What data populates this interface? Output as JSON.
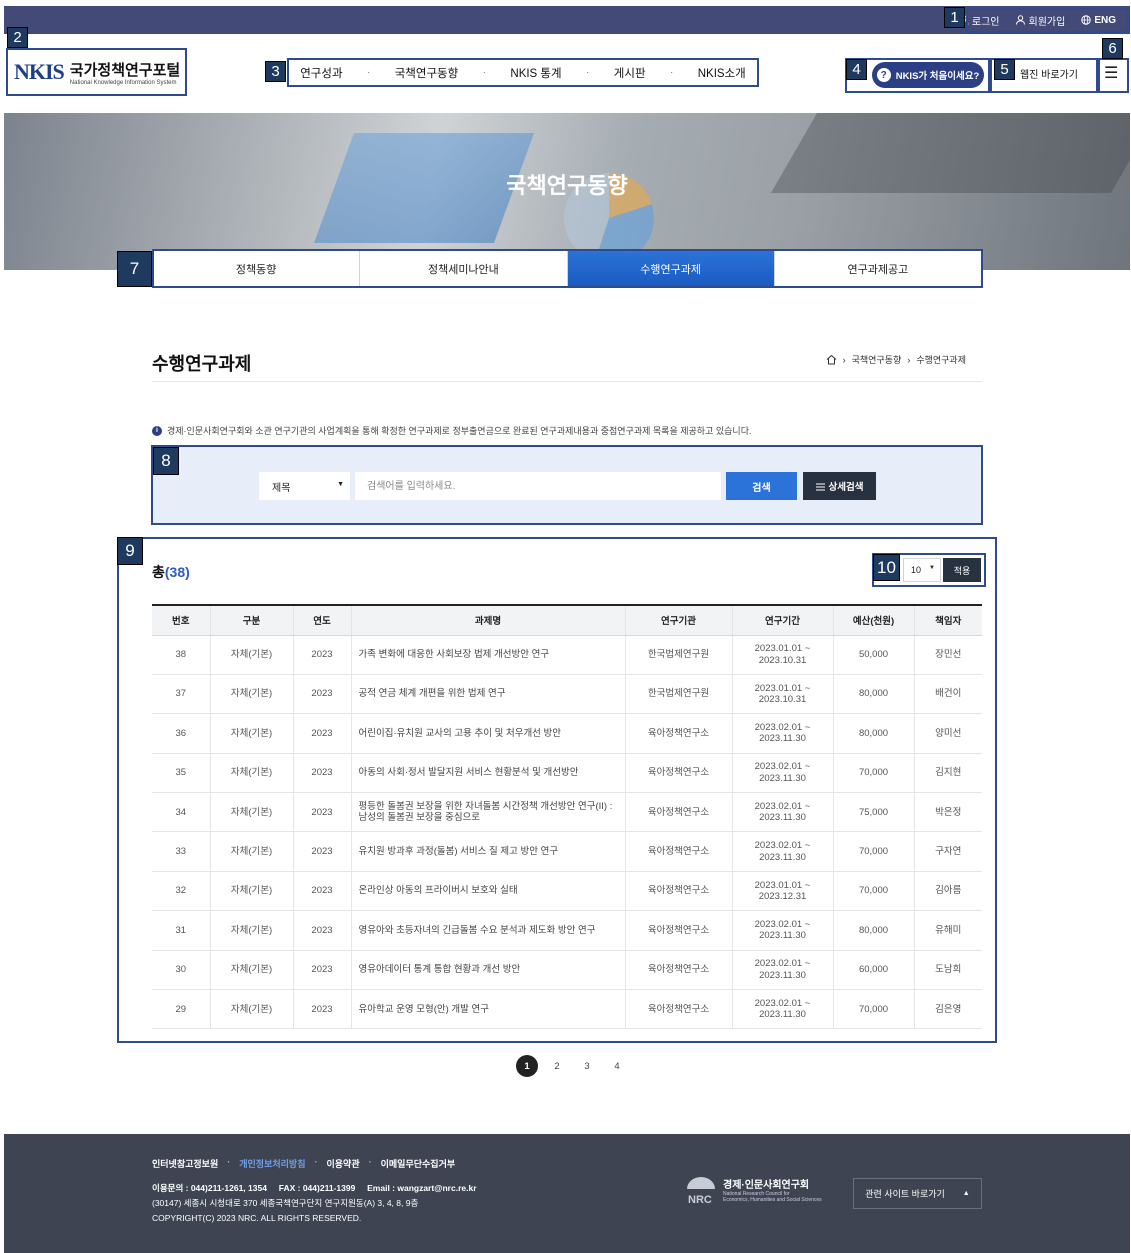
{
  "util": {
    "login": "로그인",
    "signup": "회원가입",
    "lang": "ENG"
  },
  "logo": {
    "mark": "NKIS",
    "name_ko": "국가정책연구포털",
    "name_en": "National Knowledge Information System"
  },
  "gnb": [
    "연구성과",
    "국책연구동향",
    "NKIS 통계",
    "게시판",
    "NKIS소개"
  ],
  "header": {
    "first_visit": "NKIS가 처음이세요?",
    "webzine": "웹진 바로가기"
  },
  "hero_title": "국책연구동향",
  "tabs": [
    {
      "label": "정책동향",
      "active": false
    },
    {
      "label": "정책세미나안내",
      "active": false
    },
    {
      "label": "수행연구과제",
      "active": true
    },
    {
      "label": "연구과제공고",
      "active": false
    }
  ],
  "page_title": "수행연구과제",
  "breadcrumb": [
    "국책연구동향",
    "수행연구과제"
  ],
  "notice": "경제·인문사회연구회와 소관 연구기관의 사업계획을 통해 확정한 연구과제로 정부출연금으로 완료된 연구과제내용과 중점연구과제 목록을 제공하고 있습니다.",
  "search": {
    "field": "제목",
    "placeholder": "검색어를 입력하세요.",
    "button": "검색",
    "detail_button": "상세검색"
  },
  "list": {
    "total_label": "총",
    "total_count": "(38)",
    "per_page": "10",
    "apply": "적용",
    "columns": [
      "번호",
      "구분",
      "연도",
      "과제명",
      "연구기관",
      "연구기간",
      "예산(천원)",
      "책임자"
    ],
    "rows": [
      {
        "no": "38",
        "type": "자체(기본)",
        "year": "2023",
        "title": "가족 변화에 대응한 사회보장 법제 개선방안 연구",
        "org": "한국법제연구원",
        "period_start": "2023.01.01 ~",
        "period_end": "2023.10.31",
        "budget": "50,000",
        "lead": "장민선"
      },
      {
        "no": "37",
        "type": "자체(기본)",
        "year": "2023",
        "title": "공적 연금 체계 개편을 위한 법제 연구",
        "org": "한국법제연구원",
        "period_start": "2023.01.01 ~",
        "period_end": "2023.10.31",
        "budget": "80,000",
        "lead": "배건이"
      },
      {
        "no": "36",
        "type": "자체(기본)",
        "year": "2023",
        "title": "어린이집·유치원 교사의 고용 추이 및 처우개선 방안",
        "org": "육아정책연구소",
        "period_start": "2023.02.01 ~",
        "period_end": "2023.11.30",
        "budget": "80,000",
        "lead": "양미선"
      },
      {
        "no": "35",
        "type": "자체(기본)",
        "year": "2023",
        "title": "아동의 사회·정서 발달지원 서비스 현황분석 및 개선방안",
        "org": "육아정책연구소",
        "period_start": "2023.02.01 ~",
        "period_end": "2023.11.30",
        "budget": "70,000",
        "lead": "김지현"
      },
      {
        "no": "34",
        "type": "자체(기본)",
        "year": "2023",
        "title": "평등한 돌봄권 보장을 위한 자녀돌봄 시간정책 개선방안 연구(II) : 남성의 돌봄권 보장을 중심으로",
        "org": "육아정책연구소",
        "period_start": "2023.02.01 ~",
        "period_end": "2023.11.30",
        "budget": "75,000",
        "lead": "박은정"
      },
      {
        "no": "33",
        "type": "자체(기본)",
        "year": "2023",
        "title": "유치원 방과후 과정(돌봄) 서비스 질 제고 방안 연구",
        "org": "육아정책연구소",
        "period_start": "2023.02.01 ~",
        "period_end": "2023.11.30",
        "budget": "70,000",
        "lead": "구자연"
      },
      {
        "no": "32",
        "type": "자체(기본)",
        "year": "2023",
        "title": "온라인상 아동의 프라이버시 보호와 실태",
        "org": "육아정책연구소",
        "period_start": "2023.01.01 ~",
        "period_end": "2023.12.31",
        "budget": "70,000",
        "lead": "김아름"
      },
      {
        "no": "31",
        "type": "자체(기본)",
        "year": "2023",
        "title": "영유아와 초등자녀의 긴급돌봄 수요 분석과 제도화 방안 연구",
        "org": "육아정책연구소",
        "period_start": "2023.02.01 ~",
        "period_end": "2023.11.30",
        "budget": "80,000",
        "lead": "유해미"
      },
      {
        "no": "30",
        "type": "자체(기본)",
        "year": "2023",
        "title": "영유아데이터 통계 통합 현황과 개선 방안",
        "org": "육아정책연구소",
        "period_start": "2023.02.01 ~",
        "period_end": "2023.11.30",
        "budget": "60,000",
        "lead": "도남희"
      },
      {
        "no": "29",
        "type": "자체(기본)",
        "year": "2023",
        "title": "유아학교 운영 모형(안) 개발 연구",
        "org": "육아정책연구소",
        "period_start": "2023.02.01 ~",
        "period_end": "2023.11.30",
        "budget": "70,000",
        "lead": "김은영"
      }
    ]
  },
  "pagination": {
    "pages": [
      "1",
      "2",
      "3",
      "4"
    ],
    "current": "1"
  },
  "footer": {
    "links": [
      "인터넷참고정보원",
      "개인정보처리방침",
      "이용약관",
      "이메일무단수집거부"
    ],
    "contact_label": "이용문의 : 044)211-1261, 1354",
    "fax_label": "FAX : 044)211-1399",
    "email_label": "Email : wangzart@nrc.re.kr",
    "address": "(30147) 세종시 시청대로 370 세종국책연구단지 연구지원동(A) 3, 4, 8, 9층",
    "copyright": "COPYRIGHT(C) 2023 NRC. ALL RIGHTS RESERVED.",
    "nrc_ko": "경제·인문사회연구회",
    "nrc_en1": "National Research Council for",
    "nrc_en2": "Economics, Humanities and Social Sciences",
    "related": "관련 사이트 바로가기"
  },
  "annotations": [
    "1",
    "2",
    "3",
    "4",
    "5",
    "6",
    "7",
    "8",
    "9",
    "10"
  ]
}
